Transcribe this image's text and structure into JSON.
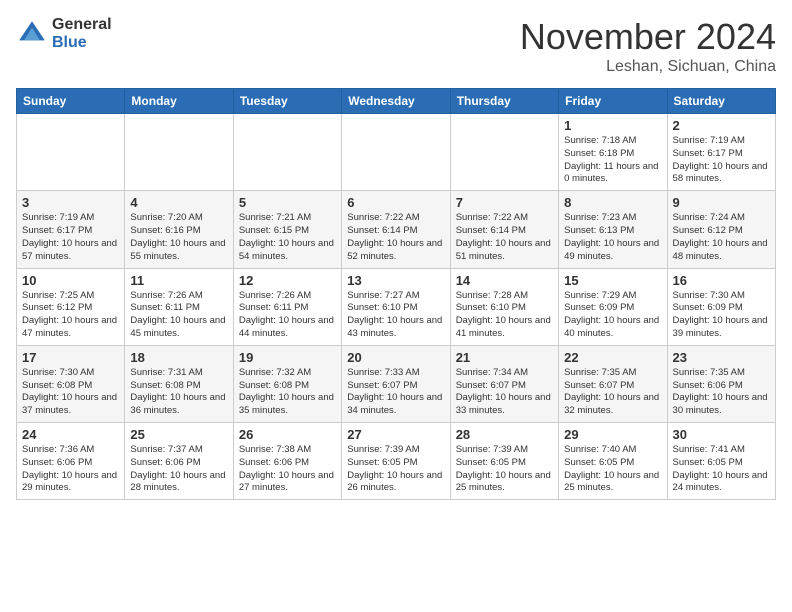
{
  "header": {
    "logo_general": "General",
    "logo_blue": "Blue",
    "title": "November 2024",
    "location": "Leshan, Sichuan, China"
  },
  "days_of_week": [
    "Sunday",
    "Monday",
    "Tuesday",
    "Wednesday",
    "Thursday",
    "Friday",
    "Saturday"
  ],
  "weeks": [
    [
      {
        "day": "",
        "info": ""
      },
      {
        "day": "",
        "info": ""
      },
      {
        "day": "",
        "info": ""
      },
      {
        "day": "",
        "info": ""
      },
      {
        "day": "",
        "info": ""
      },
      {
        "day": "1",
        "info": "Sunrise: 7:18 AM\nSunset: 6:18 PM\nDaylight: 11 hours and 0 minutes."
      },
      {
        "day": "2",
        "info": "Sunrise: 7:19 AM\nSunset: 6:17 PM\nDaylight: 10 hours and 58 minutes."
      }
    ],
    [
      {
        "day": "3",
        "info": "Sunrise: 7:19 AM\nSunset: 6:17 PM\nDaylight: 10 hours and 57 minutes."
      },
      {
        "day": "4",
        "info": "Sunrise: 7:20 AM\nSunset: 6:16 PM\nDaylight: 10 hours and 55 minutes."
      },
      {
        "day": "5",
        "info": "Sunrise: 7:21 AM\nSunset: 6:15 PM\nDaylight: 10 hours and 54 minutes."
      },
      {
        "day": "6",
        "info": "Sunrise: 7:22 AM\nSunset: 6:14 PM\nDaylight: 10 hours and 52 minutes."
      },
      {
        "day": "7",
        "info": "Sunrise: 7:22 AM\nSunset: 6:14 PM\nDaylight: 10 hours and 51 minutes."
      },
      {
        "day": "8",
        "info": "Sunrise: 7:23 AM\nSunset: 6:13 PM\nDaylight: 10 hours and 49 minutes."
      },
      {
        "day": "9",
        "info": "Sunrise: 7:24 AM\nSunset: 6:12 PM\nDaylight: 10 hours and 48 minutes."
      }
    ],
    [
      {
        "day": "10",
        "info": "Sunrise: 7:25 AM\nSunset: 6:12 PM\nDaylight: 10 hours and 47 minutes."
      },
      {
        "day": "11",
        "info": "Sunrise: 7:26 AM\nSunset: 6:11 PM\nDaylight: 10 hours and 45 minutes."
      },
      {
        "day": "12",
        "info": "Sunrise: 7:26 AM\nSunset: 6:11 PM\nDaylight: 10 hours and 44 minutes."
      },
      {
        "day": "13",
        "info": "Sunrise: 7:27 AM\nSunset: 6:10 PM\nDaylight: 10 hours and 43 minutes."
      },
      {
        "day": "14",
        "info": "Sunrise: 7:28 AM\nSunset: 6:10 PM\nDaylight: 10 hours and 41 minutes."
      },
      {
        "day": "15",
        "info": "Sunrise: 7:29 AM\nSunset: 6:09 PM\nDaylight: 10 hours and 40 minutes."
      },
      {
        "day": "16",
        "info": "Sunrise: 7:30 AM\nSunset: 6:09 PM\nDaylight: 10 hours and 39 minutes."
      }
    ],
    [
      {
        "day": "17",
        "info": "Sunrise: 7:30 AM\nSunset: 6:08 PM\nDaylight: 10 hours and 37 minutes."
      },
      {
        "day": "18",
        "info": "Sunrise: 7:31 AM\nSunset: 6:08 PM\nDaylight: 10 hours and 36 minutes."
      },
      {
        "day": "19",
        "info": "Sunrise: 7:32 AM\nSunset: 6:08 PM\nDaylight: 10 hours and 35 minutes."
      },
      {
        "day": "20",
        "info": "Sunrise: 7:33 AM\nSunset: 6:07 PM\nDaylight: 10 hours and 34 minutes."
      },
      {
        "day": "21",
        "info": "Sunrise: 7:34 AM\nSunset: 6:07 PM\nDaylight: 10 hours and 33 minutes."
      },
      {
        "day": "22",
        "info": "Sunrise: 7:35 AM\nSunset: 6:07 PM\nDaylight: 10 hours and 32 minutes."
      },
      {
        "day": "23",
        "info": "Sunrise: 7:35 AM\nSunset: 6:06 PM\nDaylight: 10 hours and 30 minutes."
      }
    ],
    [
      {
        "day": "24",
        "info": "Sunrise: 7:36 AM\nSunset: 6:06 PM\nDaylight: 10 hours and 29 minutes."
      },
      {
        "day": "25",
        "info": "Sunrise: 7:37 AM\nSunset: 6:06 PM\nDaylight: 10 hours and 28 minutes."
      },
      {
        "day": "26",
        "info": "Sunrise: 7:38 AM\nSunset: 6:06 PM\nDaylight: 10 hours and 27 minutes."
      },
      {
        "day": "27",
        "info": "Sunrise: 7:39 AM\nSunset: 6:05 PM\nDaylight: 10 hours and 26 minutes."
      },
      {
        "day": "28",
        "info": "Sunrise: 7:39 AM\nSunset: 6:05 PM\nDaylight: 10 hours and 25 minutes."
      },
      {
        "day": "29",
        "info": "Sunrise: 7:40 AM\nSunset: 6:05 PM\nDaylight: 10 hours and 25 minutes."
      },
      {
        "day": "30",
        "info": "Sunrise: 7:41 AM\nSunset: 6:05 PM\nDaylight: 10 hours and 24 minutes."
      }
    ]
  ]
}
